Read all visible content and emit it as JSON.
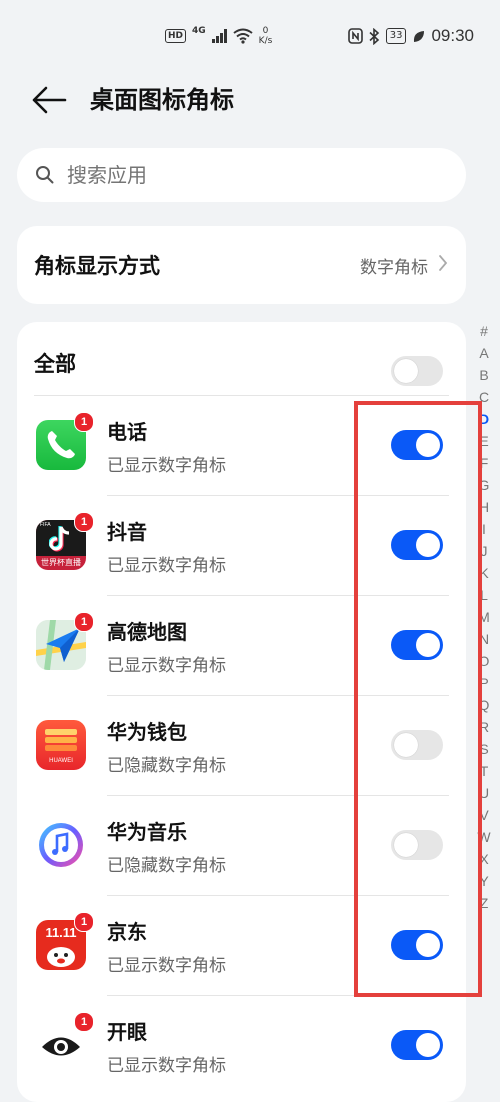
{
  "statusbar": {
    "hd": "HD",
    "network": "4G",
    "netspeed_value": "0",
    "netspeed_unit": "K/s",
    "battery": "33",
    "time": "09:30"
  },
  "header": {
    "title": "桌面图标角标"
  },
  "search": {
    "placeholder": "搜索应用"
  },
  "badge_mode": {
    "label": "角标显示方式",
    "value": "数字角标"
  },
  "all": {
    "label": "全部",
    "on": false
  },
  "apps": [
    {
      "name": "电话",
      "status": "已显示数字角标",
      "badge": "1",
      "on": true
    },
    {
      "name": "抖音",
      "status": "已显示数字角标",
      "badge": "1",
      "on": true,
      "icon_text": "世界杯直播",
      "icon_top": "FIFA"
    },
    {
      "name": "高德地图",
      "status": "已显示数字角标",
      "badge": "1",
      "on": true
    },
    {
      "name": "华为钱包",
      "status": "已隐藏数字角标",
      "badge": "",
      "on": false,
      "icon_text": "HUAWEI"
    },
    {
      "name": "华为音乐",
      "status": "已隐藏数字角标",
      "badge": "",
      "on": false
    },
    {
      "name": "京东",
      "status": "已显示数字角标",
      "badge": "1",
      "on": true,
      "icon_text": "11.11"
    },
    {
      "name": "开眼",
      "status": "已显示数字角标",
      "badge": "1",
      "on": true
    }
  ],
  "index_letters": [
    "#",
    "A",
    "B",
    "C",
    "D",
    "E",
    "F",
    "G",
    "H",
    "I",
    "J",
    "K",
    "L",
    "M",
    "N",
    "O",
    "P",
    "Q",
    "R",
    "S",
    "T",
    "U",
    "V",
    "W",
    "X",
    "Y",
    "Z"
  ],
  "active_letter": "D",
  "colors": {
    "accent": "#0a59f7",
    "highlight_box": "#e4403c",
    "badge": "#e8232b"
  }
}
